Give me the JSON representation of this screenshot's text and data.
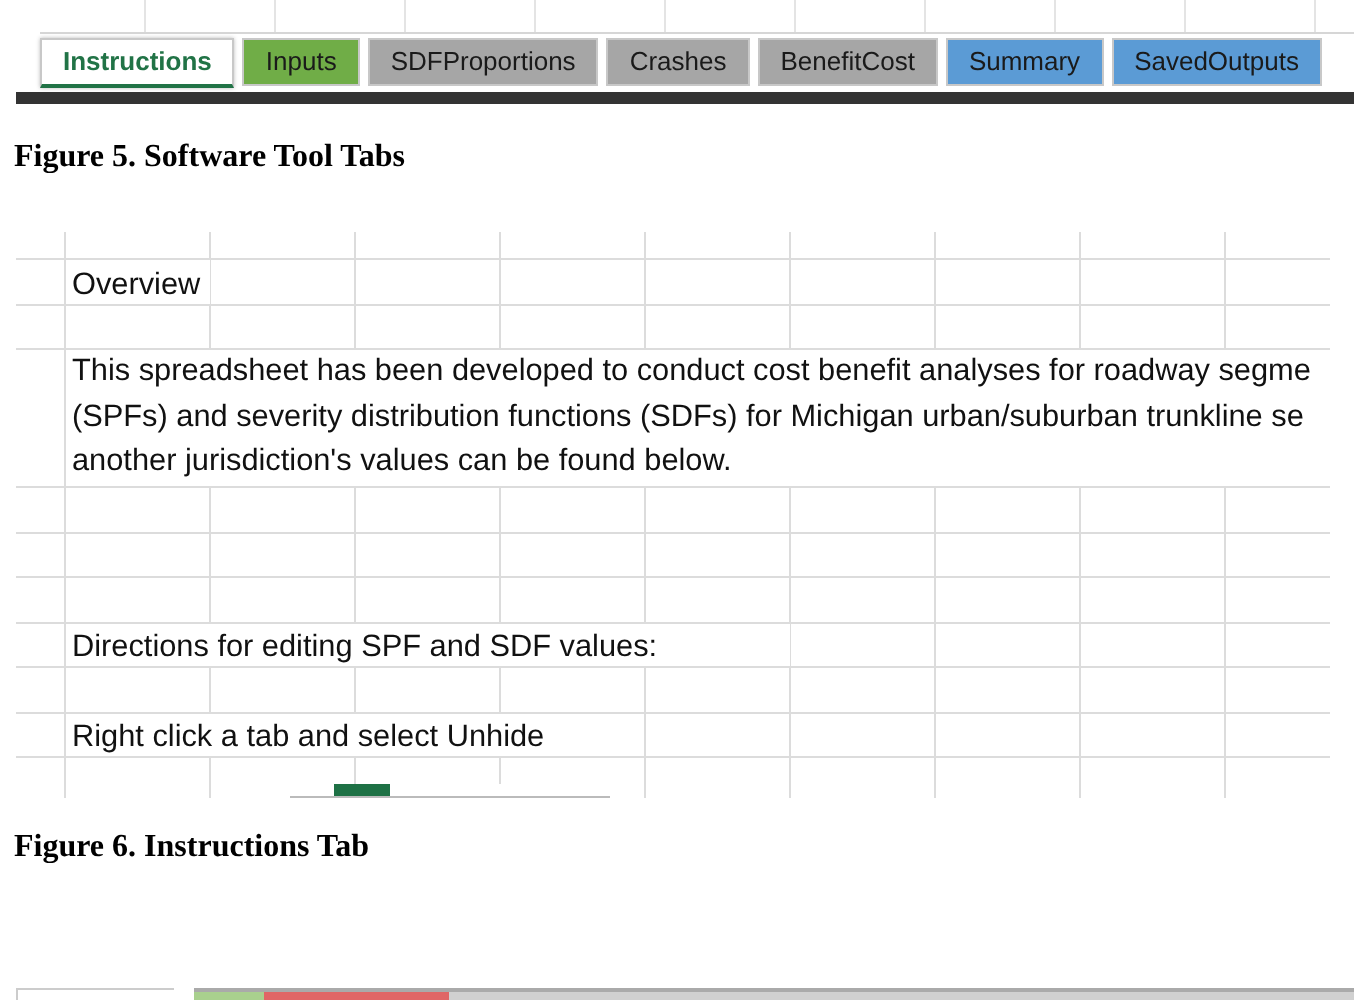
{
  "tabs": [
    {
      "label": "Instructions",
      "selected": true,
      "color": "#ffffff"
    },
    {
      "label": "Inputs",
      "selected": false,
      "color": "#70ad47"
    },
    {
      "label": "SDFProportions",
      "selected": false,
      "color": "#a6a6a6"
    },
    {
      "label": "Crashes",
      "selected": false,
      "color": "#a6a6a6"
    },
    {
      "label": "BenefitCost",
      "selected": false,
      "color": "#a6a6a6"
    },
    {
      "label": "Summary",
      "selected": false,
      "color": "#5b9bd5"
    },
    {
      "label": "SavedOutputs",
      "selected": false,
      "color": "#5b9bd5"
    }
  ],
  "caption_1": "Figure 5. Software Tool Tabs",
  "sheet": {
    "rows": [
      {
        "kind": "empty"
      },
      {
        "kind": "text",
        "text": "Overview"
      },
      {
        "kind": "empty"
      },
      {
        "kind": "paragraph",
        "text": "This spreadsheet has been developed to conduct cost benefit analyses for roadway segme\n(SPFs) and severity distribution functions (SDFs) for Michigan urban/suburban trunkline se\nanother jurisdiction's values can be found below."
      },
      {
        "kind": "empty"
      },
      {
        "kind": "empty"
      },
      {
        "kind": "empty"
      },
      {
        "kind": "text",
        "text": "Directions for editing SPF and SDF values:"
      },
      {
        "kind": "empty"
      },
      {
        "kind": "text",
        "text": "Right click a tab and select Unhide"
      },
      {
        "kind": "image"
      }
    ]
  },
  "caption_2": "Figure 6. Instructions Tab"
}
